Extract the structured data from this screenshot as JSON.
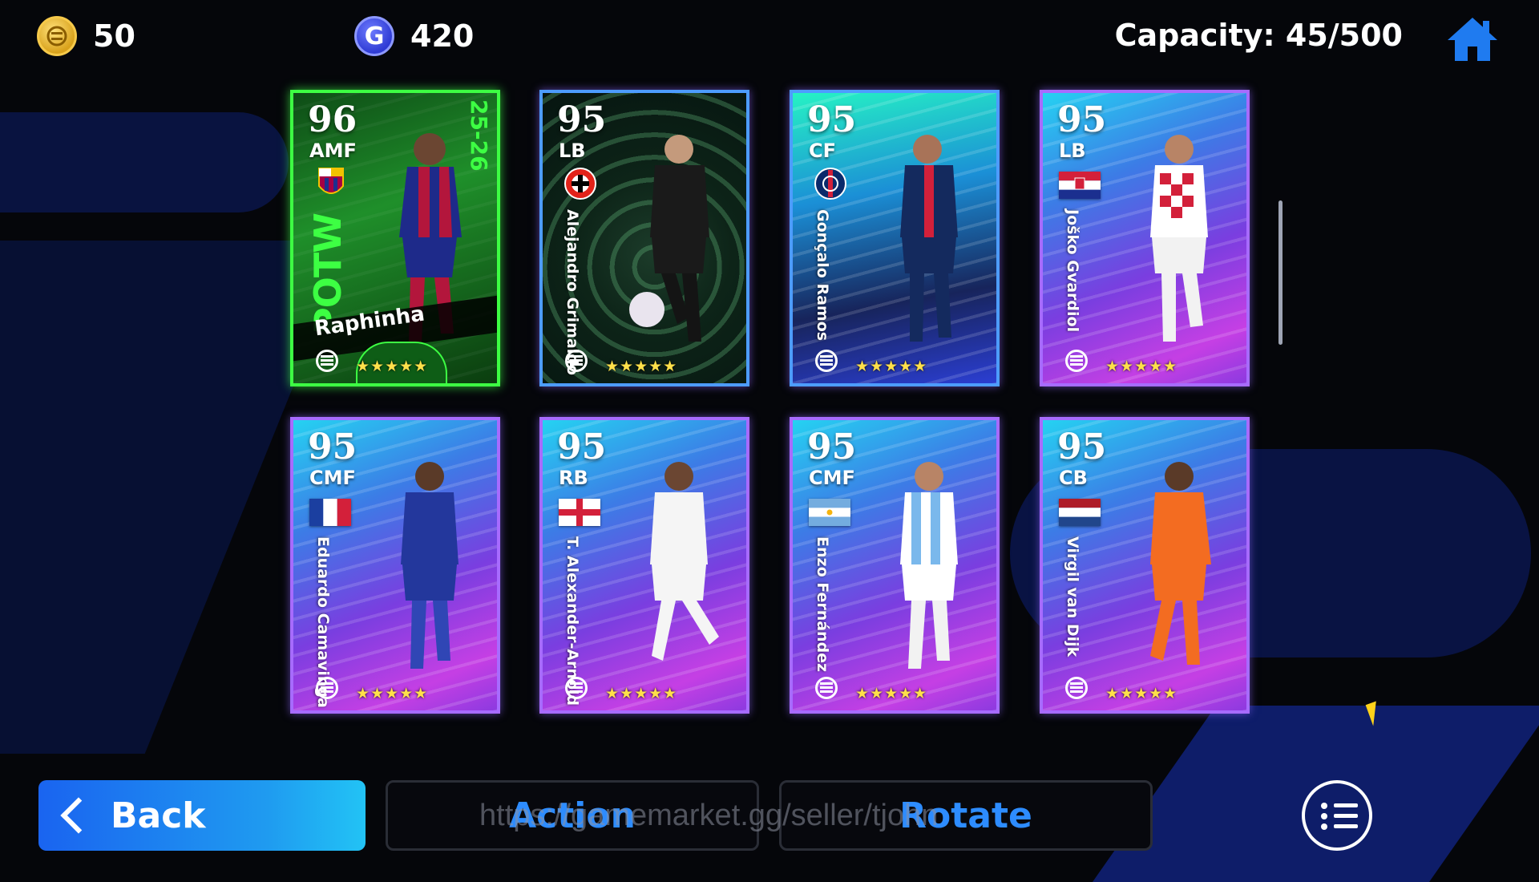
{
  "currency": {
    "coins": {
      "icon": "efootball-coin-icon",
      "value": "50"
    },
    "gp": {
      "icon": "gp-coin-icon",
      "icon_letter": "G",
      "value": "420"
    }
  },
  "capacity": "Capacity: 45/500",
  "home_icon": "home-icon",
  "cards": [
    {
      "rating": "96",
      "position": "AMF",
      "name": "Raphinha",
      "badge": "fc-barcelona-crest",
      "label": "POTW",
      "season": "25-26",
      "stars": "★★★★★",
      "style": "potw"
    },
    {
      "rating": "95",
      "position": "LB",
      "name": "Alejandro Grimaldo",
      "badge": "bayer-leverkusen-crest",
      "stars": "★★★★★",
      "style": "hex"
    },
    {
      "rating": "95",
      "position": "CF",
      "name": "Gonçalo Ramos",
      "badge": "psg-crest",
      "stars": "★★★★★",
      "style": "crystal"
    },
    {
      "rating": "95",
      "position": "LB",
      "name": "Joško Gvardiol",
      "badge": "croatia-flag",
      "stars": "★★★★★",
      "style": "std"
    },
    {
      "rating": "95",
      "position": "CMF",
      "name": "Eduardo Camavinga",
      "badge": "france-flag",
      "stars": "★★★★★",
      "style": "std"
    },
    {
      "rating": "95",
      "position": "RB",
      "name": "T. Alexander-Arnold",
      "badge": "england-flag",
      "stars": "★★★★★",
      "style": "std"
    },
    {
      "rating": "95",
      "position": "CMF",
      "name": "Enzo Fernández",
      "badge": "argentina-flag",
      "stars": "★★★★★",
      "style": "std"
    },
    {
      "rating": "95",
      "position": "CB",
      "name": "Virgil van Dijk",
      "badge": "netherlands-flag",
      "stars": "★★★★★",
      "style": "std"
    }
  ],
  "buttons": {
    "back": "Back",
    "action": "Action",
    "rotate": "Rotate",
    "menu_icon": "list-menu-icon"
  },
  "watermark": "https://gamemarket.gg/seller/tjohn",
  "colors": {
    "accent_blue": "#1f7bf0",
    "potw_green": "#3dff43",
    "star_gold": "#ffe04a"
  }
}
